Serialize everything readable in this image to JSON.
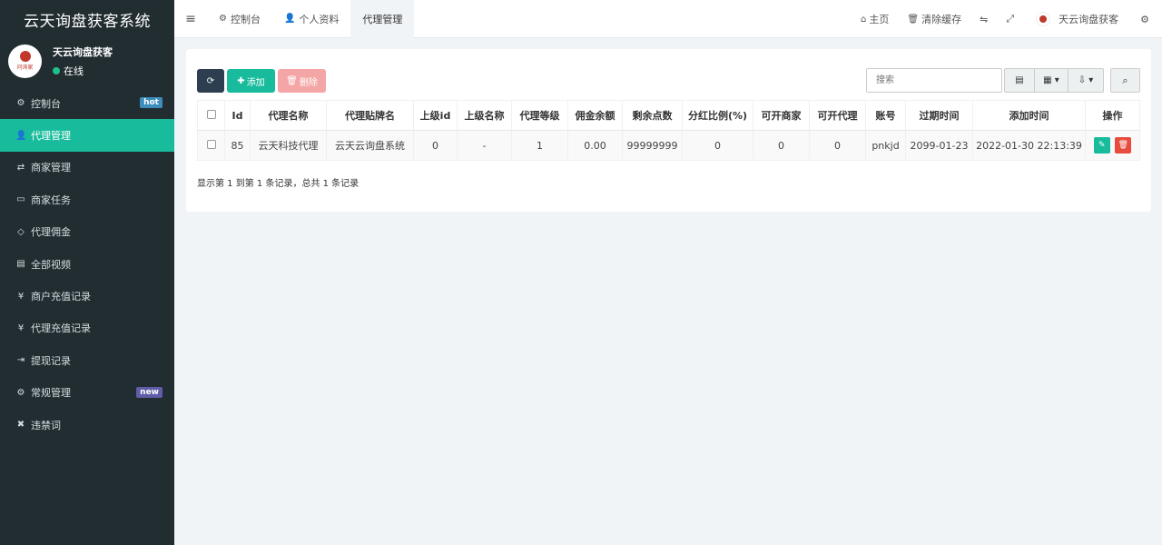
{
  "app": {
    "title": "云天询盘获客系统"
  },
  "user": {
    "name": "天云询盘获客",
    "status": "在线",
    "avatar_text": "问询家"
  },
  "sidebar": {
    "items": [
      {
        "label": "控制台",
        "icon": "dashboard-icon",
        "glyph": "⚙",
        "badge": "hot"
      },
      {
        "label": "代理管理",
        "icon": "user-plus-icon",
        "glyph": "👤",
        "badge": ""
      },
      {
        "label": "商家管理",
        "icon": "handshake-icon",
        "glyph": "⇄",
        "badge": ""
      },
      {
        "label": "商家任务",
        "icon": "keyboard-icon",
        "glyph": "▭",
        "badge": ""
      },
      {
        "label": "代理佣金",
        "icon": "diamond-icon",
        "glyph": "◇",
        "badge": ""
      },
      {
        "label": "全部视频",
        "icon": "file-video-icon",
        "glyph": "▤",
        "badge": ""
      },
      {
        "label": "商户充值记录",
        "icon": "yen-icon",
        "glyph": "¥",
        "badge": ""
      },
      {
        "label": "代理充值记录",
        "icon": "yen-icon",
        "glyph": "¥",
        "badge": ""
      },
      {
        "label": "提现记录",
        "icon": "sign-in-icon",
        "glyph": "⇥",
        "badge": ""
      },
      {
        "label": "常规管理",
        "icon": "cogs-icon",
        "glyph": "⚙",
        "badge": "new"
      },
      {
        "label": "违禁词",
        "icon": "times-icon",
        "glyph": "✖",
        "badge": ""
      }
    ]
  },
  "navbar": {
    "tabs": [
      {
        "label": "控制台",
        "glyph": "⚙"
      },
      {
        "label": "个人资料",
        "glyph": "👤"
      },
      {
        "label": "代理管理",
        "glyph": ""
      }
    ],
    "right": {
      "home": "主页",
      "clear_cache": "清除缓存",
      "user": "天云询盘获客"
    }
  },
  "toolbar": {
    "add_label": "添加",
    "delete_label": "删除",
    "search_placeholder": "搜索"
  },
  "table": {
    "headers": [
      "Id",
      "代理名称",
      "代理贴牌名",
      "上级id",
      "上级名称",
      "代理等级",
      "佣金余额",
      "剩余点数",
      "分红比例(%)",
      "可开商家",
      "可开代理",
      "账号",
      "过期时间",
      "添加时间",
      "操作"
    ],
    "rows": [
      [
        "85",
        "云天科技代理",
        "云天云询盘系统",
        "0",
        "-",
        "1",
        "0.00",
        "99999999",
        "0",
        "0",
        "0",
        "pnkjd",
        "2099-01-23",
        "2022-01-30 22:13:39"
      ]
    ]
  },
  "pagination": {
    "info": "显示第 1 到第 1 条记录，总共 1 条记录"
  },
  "colors": {
    "sidebar_bg": "#222d32",
    "accent": "#18bc9c",
    "danger": "#e74c3c",
    "dark_button": "#2c3e50"
  }
}
